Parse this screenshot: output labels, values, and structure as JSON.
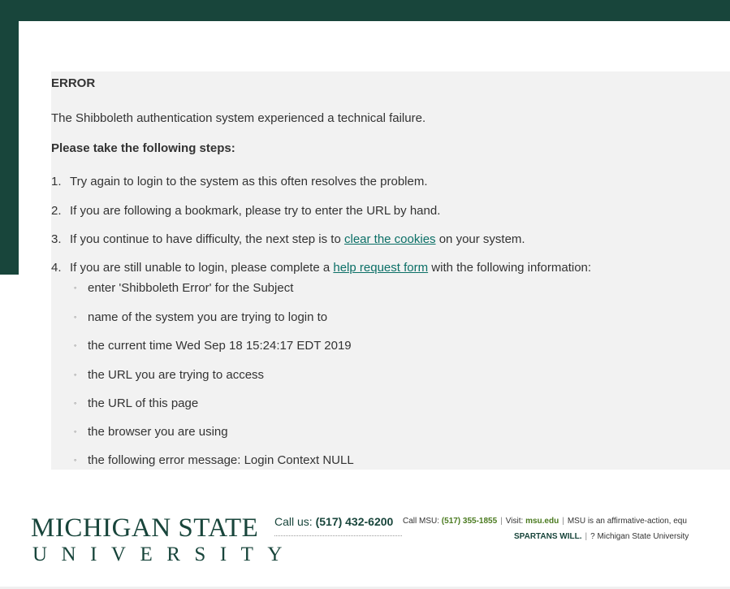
{
  "error": {
    "title": "ERROR",
    "message": "The Shibboleth authentication system experienced a technical failure.",
    "steps_heading": "Please take the following steps:",
    "steps": [
      {
        "num": "1.",
        "before": "Try again to login to the system as this often resolves the problem.",
        "link": "",
        "after": ""
      },
      {
        "num": "2.",
        "before": "If you are following a bookmark, please try to enter the URL by hand.",
        "link": "",
        "after": ""
      },
      {
        "num": "3.",
        "before": "If you continue to have difficulty, the next step is to ",
        "link": "clear the cookies",
        "after": " on your system."
      },
      {
        "num": "4.",
        "before": "If you are still unable to login, please complete a ",
        "link": "help request form",
        "after": " with the following information:"
      }
    ],
    "info_items": [
      "enter 'Shibboleth Error' for the Subject",
      "name of the system you are trying to login to",
      "the current time Wed Sep 18 15:24:17 EDT 2019",
      "the URL you are trying to access",
      "the URL of this page",
      "the browser you are using",
      "the following error message: Login Context NULL"
    ],
    "bullet": "◦"
  },
  "footer": {
    "logo_line1": "MICHIGAN STATE",
    "logo_line2": "UNIVERSITY",
    "call_us_label": "Call us: ",
    "call_us_number": "(517) 432-6200",
    "call_msu_label": "Call MSU: ",
    "call_msu_number": "(517) 355-1855",
    "separator": "|",
    "visit_label": "Visit: ",
    "visit_link": "msu.edu",
    "affirmative": "MSU is an affirmative-action, equ",
    "spartans_will": "SPARTANS WILL.",
    "copyright": "? Michigan State University"
  },
  "colors": {
    "brand_green": "#18453b",
    "link_teal": "#0b6f66",
    "panel_gray": "#f2f2f2"
  }
}
